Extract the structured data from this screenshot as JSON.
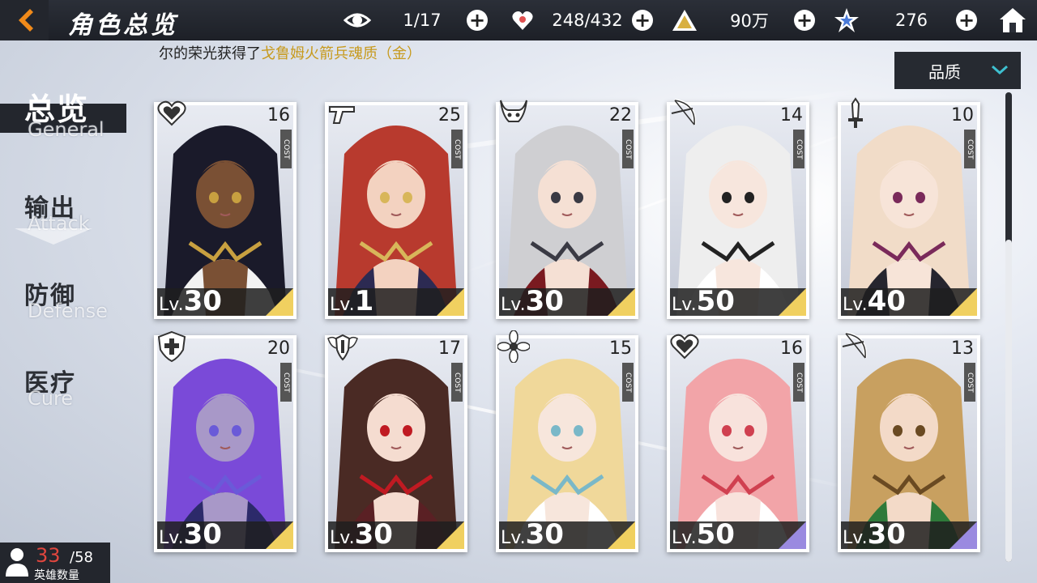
{
  "header": {
    "title": "角色总览",
    "resources": [
      {
        "icon": "eye-icon",
        "value": "1/17"
      },
      {
        "icon": "heart-hand-icon",
        "value": "248/432"
      },
      {
        "icon": "triangle-gold-icon",
        "value": "90万"
      },
      {
        "icon": "star-crystal-icon",
        "value": "276"
      }
    ],
    "plus_label": "+"
  },
  "ticker": {
    "prefix": "尔的荣光获得了",
    "highlight": "戈鲁姆火箭兵魂质（金）"
  },
  "sort": {
    "label": "品质"
  },
  "nav": [
    {
      "zh": "总览",
      "en": "General",
      "active": true
    },
    {
      "zh": "输出",
      "en": "Attack",
      "active": false
    },
    {
      "zh": "防御",
      "en": "Defense",
      "active": false
    },
    {
      "zh": "医疗",
      "en": "Cure",
      "active": false
    }
  ],
  "cards": [
    {
      "class": "heart-icon",
      "cost": "16",
      "cost_tag": "COST",
      "lv_prefix": "Lv.",
      "level": "30",
      "hair": "#1a1a2a",
      "skin": "#7a5034",
      "outfit": "#f2f2f2",
      "accent": "#c8a040",
      "rarity": "gold"
    },
    {
      "class": "gun-icon",
      "cost": "25",
      "cost_tag": "COST",
      "lv_prefix": "Lv.",
      "level": "1",
      "hair": "#b83a2e",
      "skin": "#f3d2c0",
      "outfit": "#2c2a52",
      "accent": "#d8b65a",
      "rarity": "gold"
    },
    {
      "class": "horned-mask-icon",
      "cost": "22",
      "cost_tag": "COST",
      "lv_prefix": "Lv.",
      "level": "30",
      "hair": "#cfcfd2",
      "skin": "#f5e0d4",
      "outfit": "#7a1a20",
      "accent": "#3a3a44",
      "rarity": "gold"
    },
    {
      "class": "bow-icon",
      "cost": "14",
      "cost_tag": "COST",
      "lv_prefix": "Lv.",
      "level": "50",
      "hair": "#eeeeee",
      "skin": "#f7e6dd",
      "outfit": "#ffffff",
      "accent": "#222222",
      "rarity": "gold"
    },
    {
      "class": "sword-icon",
      "cost": "10",
      "cost_tag": "COST",
      "lv_prefix": "Lv.",
      "level": "40",
      "hair": "#f1dcc8",
      "skin": "#f7e4d8",
      "outfit": "#26252e",
      "accent": "#7a2a5a",
      "rarity": "gold"
    },
    {
      "class": "shield-cross-icon",
      "cost": "20",
      "cost_tag": "COST",
      "lv_prefix": "Lv.",
      "level": "30",
      "hair": "#7a4ad8",
      "skin": "#a898c8",
      "outfit": "#2c2a6a",
      "accent": "#6a5ad8",
      "rarity": "gold"
    },
    {
      "class": "shield-wings-icon",
      "cost": "17",
      "cost_tag": "COST",
      "lv_prefix": "Lv.",
      "level": "30",
      "hair": "#4a2a24",
      "skin": "#f5dcd0",
      "outfit": "#5a2024",
      "accent": "#c01a22",
      "rarity": "gold"
    },
    {
      "class": "flower-icon",
      "cost": "15",
      "cost_tag": "COST",
      "lv_prefix": "Lv.",
      "level": "30",
      "hair": "#f0d89a",
      "skin": "#f7e6dc",
      "outfit": "#ffffff",
      "accent": "#7ab8c8",
      "rarity": "gold"
    },
    {
      "class": "heart-icon",
      "cost": "16",
      "cost_tag": "COST",
      "lv_prefix": "Lv.",
      "level": "50",
      "hair": "#f2a4a8",
      "skin": "#f8e2dc",
      "outfit": "#ffffff",
      "accent": "#d04050",
      "rarity": "purple"
    },
    {
      "class": "bow-icon",
      "cost": "13",
      "cost_tag": "COST",
      "lv_prefix": "Lv.",
      "level": "30",
      "hair": "#c8a060",
      "skin": "#f3dac8",
      "outfit": "#2e7a3a",
      "accent": "#6a4a22",
      "rarity": "purple"
    }
  ],
  "counter": {
    "current": "33",
    "total": "/58",
    "label": "英雄数量"
  },
  "colors": {
    "gold": "#f0d060",
    "purple": "#9a8ae0",
    "highlight": "#c79a1d"
  }
}
